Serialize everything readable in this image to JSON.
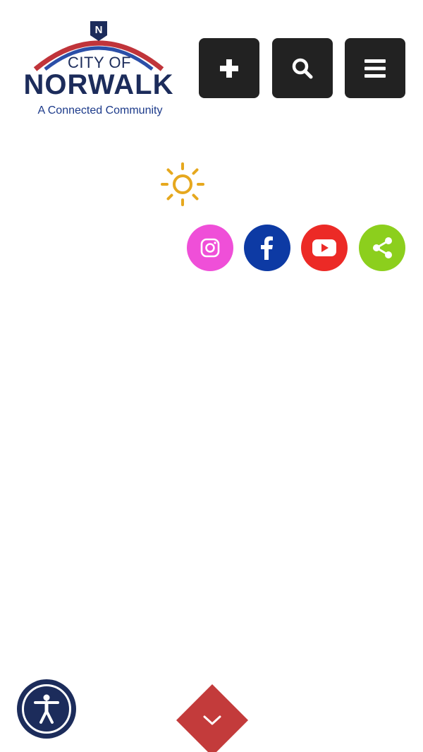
{
  "header": {
    "logo": {
      "line1": "CITY OF",
      "line2": "NORWALK",
      "tagline": "A Connected Community",
      "badge_letter": "N"
    },
    "buttons": [
      {
        "icon": "plus-icon"
      },
      {
        "icon": "search-icon"
      },
      {
        "icon": "hamburger-menu-icon"
      }
    ]
  },
  "weather": {
    "icon": "sun-icon",
    "color": "#e6a81e"
  },
  "social": [
    {
      "icon": "instagram-icon",
      "color": "#ef4fd8"
    },
    {
      "icon": "facebook-icon",
      "color": "#0d3aa4"
    },
    {
      "icon": "youtube-icon",
      "color": "#ec2a26"
    },
    {
      "icon": "share-icon",
      "color": "#8ccf1d"
    }
  ],
  "footer": {
    "accessibility_icon": "accessibility-icon",
    "scroll_icon": "chevron-down-icon",
    "scroll_color": "#c33b3b"
  },
  "colors": {
    "navy": "#1c2c5b",
    "red_arc": "#c0343a",
    "button_bg": "#222222"
  }
}
